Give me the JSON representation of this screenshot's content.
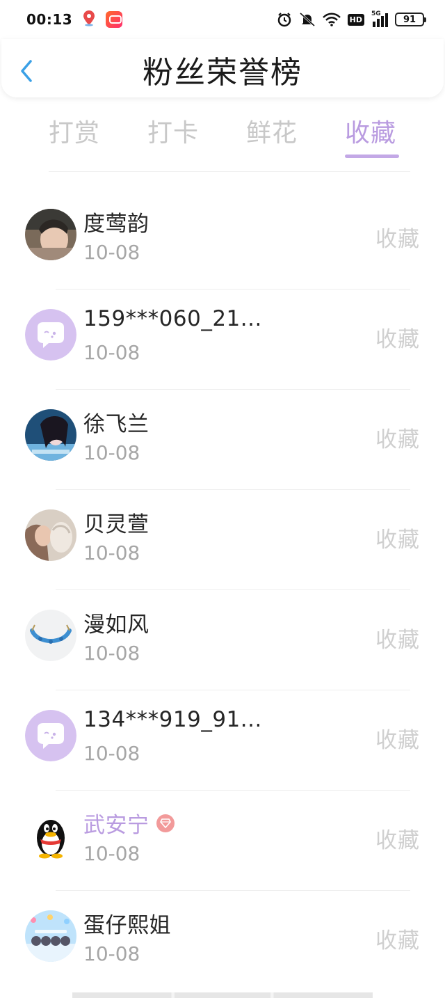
{
  "status_bar": {
    "time": "00:13",
    "signal_label": "5G",
    "hd_label": "HD",
    "battery": "91"
  },
  "header": {
    "title": "粉丝荣誉榜"
  },
  "tabs": [
    {
      "label": "打赏",
      "active": false
    },
    {
      "label": "打卡",
      "active": false
    },
    {
      "label": "鲜花",
      "active": false
    },
    {
      "label": "收藏",
      "active": true
    }
  ],
  "colors": {
    "accent": "#b99be0",
    "inactive_tab": "#c8c8c8",
    "back_arrow": "#3aa0e6",
    "vip_badge": "#f29a9a"
  },
  "fans": [
    {
      "name": "度莺韵",
      "date": "10-08",
      "action": "收藏",
      "avatar": "photo-person-icon"
    },
    {
      "name": "159***060_21...",
      "date": "10-08",
      "action": "收藏",
      "avatar": "chat-bubble-icon"
    },
    {
      "name": "徐飞兰",
      "date": "10-08",
      "action": "收藏",
      "avatar": "photo-person-icon"
    },
    {
      "name": "贝灵萱",
      "date": "10-08",
      "action": "收藏",
      "avatar": "photo-person-icon"
    },
    {
      "name": "漫如风",
      "date": "10-08",
      "action": "收藏",
      "avatar": "bracelet-icon"
    },
    {
      "name": "134***919_91...",
      "date": "10-08",
      "action": "收藏",
      "avatar": "chat-bubble-icon"
    },
    {
      "name": "武安宁",
      "date": "10-08",
      "action": "收藏",
      "avatar": "penguin-icon",
      "vip": true
    },
    {
      "name": "蛋仔熙姐",
      "date": "10-08",
      "action": "收藏",
      "avatar": "cartoon-group-icon"
    }
  ]
}
